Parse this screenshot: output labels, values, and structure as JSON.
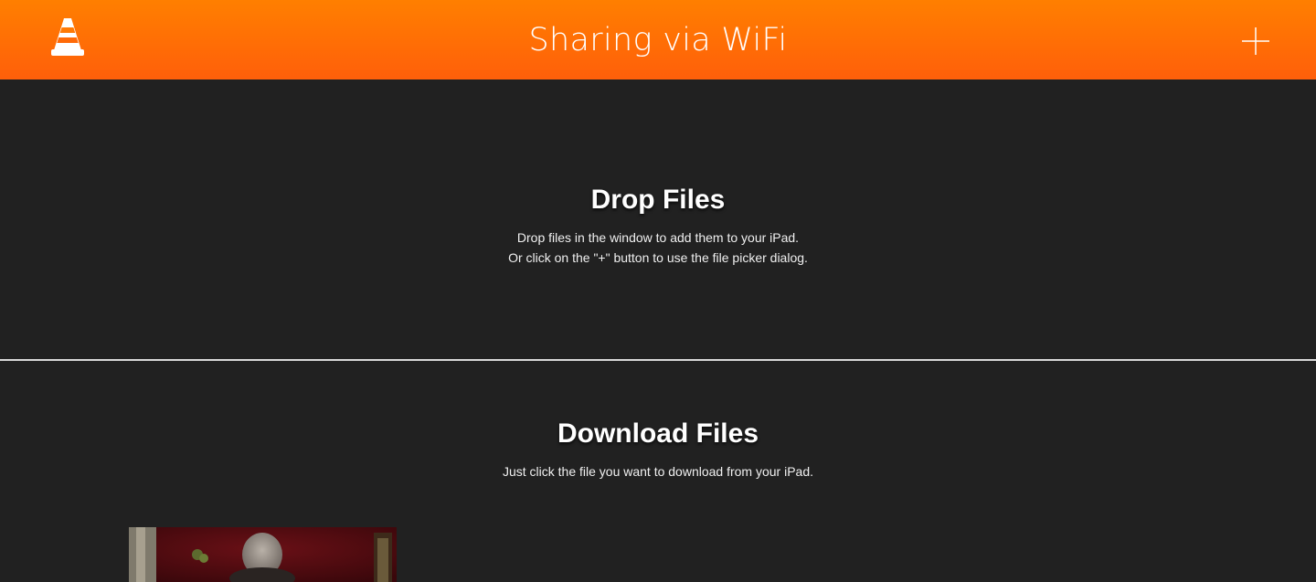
{
  "header": {
    "title": "Sharing via WiFi",
    "logo_icon": "vlc-cone-icon",
    "add_icon": "plus-icon",
    "gradient_top": "#ff7f00",
    "gradient_bottom": "#ff5f0a"
  },
  "drop": {
    "heading": "Drop Files",
    "line1": "Drop files in the window to add them to your iPad.",
    "line2": "Or click on the \"+\" button to use the file picker dialog."
  },
  "download": {
    "heading": "Download Files",
    "description": "Just click the file you want to download from your iPad.",
    "files": [
      {
        "thumbnail_icon": "video-thumbnail"
      }
    ]
  },
  "colors": {
    "background": "#212121",
    "divider": "#d9d9d9"
  }
}
